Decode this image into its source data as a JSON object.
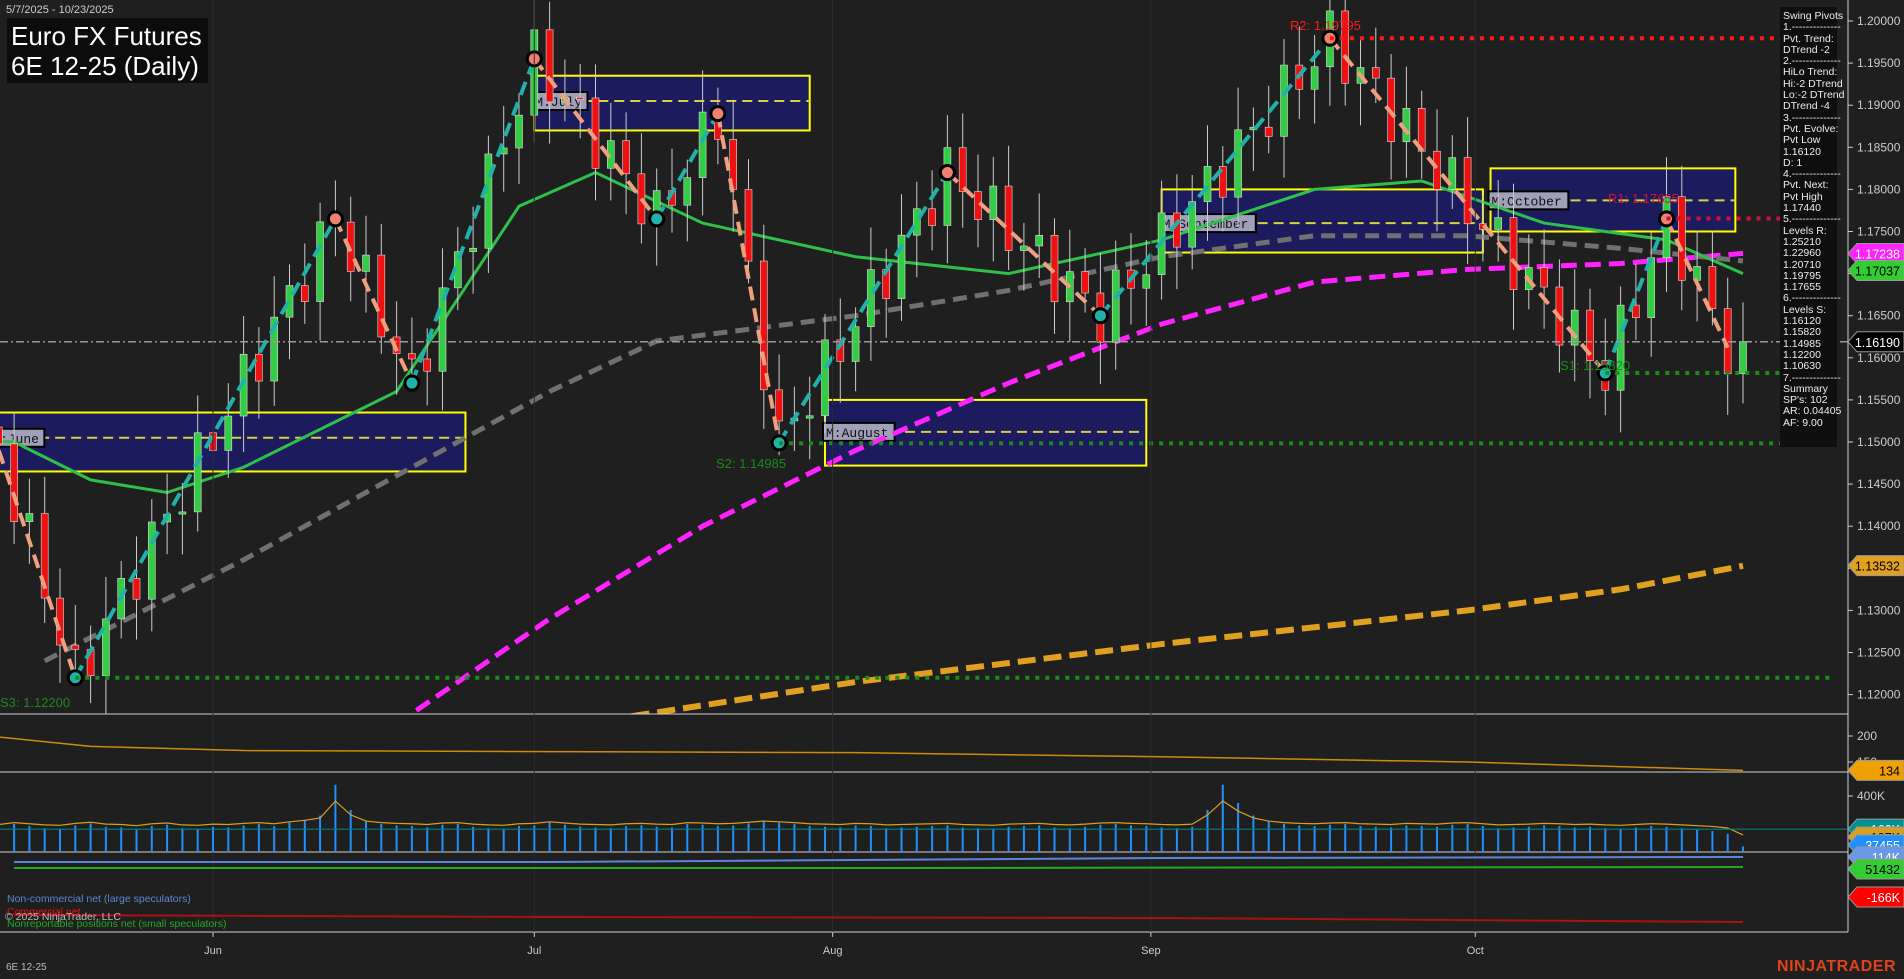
{
  "header": {
    "date_range": "5/7/2025 - 10/23/2025",
    "title_line1": "Euro FX Futures",
    "title_line2": "6E 12-25 (Daily)"
  },
  "swing_panel": [
    "Swing Pivots",
    "1.--------------",
    "Pvt. Trend:",
    "DTrend -2",
    "2.--------------",
    "HiLo Trend:",
    "Hi:-2 DTrend",
    "Lo:-2 DTrend",
    "DTrend -4",
    "3.--------------",
    "Pvt. Evolve:",
    "Pvt Low",
    "1.16120",
    "D: 1",
    "4.--------------",
    "Pvt. Next:",
    "Pvt High",
    "1.17440",
    "5.--------------",
    "Levels R:",
    "1.25210",
    "1.22960",
    "1.20710",
    "1.19795",
    "1.17655",
    "6.--------------",
    "Levels S:",
    "1.16120",
    "1.15820",
    "1.14985",
    "1.12200",
    "1.10630",
    "7.--------------",
    "Summary",
    "SP's: 102",
    "AR: 0.04405",
    "AF: 9.00"
  ],
  "legend": {
    "noncommercial": "Non-commercial net (large speculators)",
    "commercial": "Commercial net",
    "copyright": "© 2025 NinjaTrader, LLC",
    "nonreportable": "Nonreportable positions net (small speculators)"
  },
  "footer": {
    "instrument": "6E 12-25",
    "logo": "NINJATRADER"
  },
  "chart_data": {
    "type": "candlestick",
    "price_axis": {
      "ticks": [
        "1.20000",
        "1.19500",
        "1.19000",
        "1.18500",
        "1.18000",
        "1.17500",
        "1.17000",
        "1.16500",
        "1.16000",
        "1.15500",
        "1.15000",
        "1.14500",
        "1.14000",
        "1.13500",
        "1.13000",
        "1.12500",
        "1.12000"
      ],
      "range": [
        1.1165,
        1.2025
      ]
    },
    "time_axis": [
      {
        "label": "Jun",
        "bar": 18
      },
      {
        "label": "Jul",
        "bar": 39
      },
      {
        "label": "Aug",
        "bar": 58.5
      },
      {
        "label": "Sep",
        "bar": 79.3
      },
      {
        "label": "Oct",
        "bar": 100.5
      }
    ],
    "swing_pivots": [
      [
        4,
        1.149
      ],
      [
        9,
        1.122
      ],
      [
        26,
        1.1765
      ],
      [
        31,
        1.157
      ],
      [
        39,
        1.1955
      ],
      [
        47,
        1.1765
      ],
      [
        51,
        1.189
      ],
      [
        55,
        1.1499
      ],
      [
        66,
        1.182
      ],
      [
        76,
        1.165
      ],
      [
        91,
        1.19795
      ],
      [
        109,
        1.1582
      ],
      [
        113,
        1.1765
      ],
      [
        117,
        1.1612
      ],
      [
        118,
        1.1619
      ]
    ],
    "levels": [
      {
        "label": "R2: 1.19795",
        "price": 1.19795,
        "from": 91,
        "color": "#ff1a1a"
      },
      {
        "label": "R1: 1.17655",
        "price": 1.17655,
        "from": 113,
        "color": "#d0103a"
      },
      {
        "label": "S1: 1.15820",
        "price": 1.1582,
        "from": 109,
        "color": "#1a8a1a"
      },
      {
        "label": "S2: 1.14985",
        "price": 1.14985,
        "from": 55,
        "color": "#1a8a1a"
      },
      {
        "label": "S3: 1.12200",
        "price": 1.122,
        "from": 9,
        "color": "#1a8a1a"
      }
    ],
    "monthly_boxes": [
      {
        "label": "M:June",
        "from": 3.5,
        "to": 34.5,
        "high": 1.1535,
        "low": 1.1465,
        "mid": 1.1505
      },
      {
        "label": "M:July",
        "from": 39,
        "to": 57,
        "high": 1.1935,
        "low": 1.187,
        "mid": 1.1905
      },
      {
        "label": "M:August",
        "from": 58,
        "to": 79,
        "high": 1.155,
        "low": 1.1472,
        "mid": 1.1512
      },
      {
        "label": "M:September",
        "from": 80,
        "to": 101,
        "high": 1.18,
        "low": 1.1725,
        "mid": 1.176
      },
      {
        "label": "M:October",
        "from": 101.5,
        "to": 117.5,
        "high": 1.1825,
        "low": 1.175,
        "mid": 1.1787
      }
    ],
    "ma_green": [
      [
        0,
        1.1505
      ],
      [
        5,
        1.15
      ],
      [
        10,
        1.1455
      ],
      [
        15,
        1.144
      ],
      [
        20,
        1.147
      ],
      [
        30,
        1.156
      ],
      [
        38,
        1.178
      ],
      [
        43,
        1.182
      ],
      [
        50,
        1.176
      ],
      [
        60,
        1.172
      ],
      [
        70,
        1.17
      ],
      [
        80,
        1.174
      ],
      [
        90,
        1.18
      ],
      [
        97,
        1.181
      ],
      [
        105,
        1.176
      ],
      [
        113,
        1.174
      ],
      [
        118,
        1.17
      ]
    ],
    "ma_gray": [
      [
        7,
        1.124
      ],
      [
        20,
        1.136
      ],
      [
        30,
        1.146
      ],
      [
        40,
        1.156
      ],
      [
        47,
        1.162
      ],
      [
        60,
        1.165
      ],
      [
        70,
        1.168
      ],
      [
        80,
        1.172
      ],
      [
        90,
        1.1745
      ],
      [
        100,
        1.1745
      ],
      [
        110,
        1.173
      ],
      [
        118,
        1.1715
      ]
    ],
    "ma_magenta": [
      [
        30,
        1.1165
      ],
      [
        40,
        1.129
      ],
      [
        50,
        1.14
      ],
      [
        60,
        1.149
      ],
      [
        70,
        1.157
      ],
      [
        80,
        1.164
      ],
      [
        90,
        1.169
      ],
      [
        100,
        1.1705
      ],
      [
        110,
        1.1712
      ],
      [
        118,
        1.1724
      ]
    ],
    "ma_orange": [
      [
        42,
        1.1165
      ],
      [
        60,
        1.1215
      ],
      [
        80,
        1.126
      ],
      [
        100,
        1.13
      ],
      [
        110,
        1.1325
      ],
      [
        118,
        1.1353
      ]
    ],
    "last_price": 1.1619,
    "price_tags": [
      {
        "label": "1.17238",
        "color": "#ff22ff"
      },
      {
        "label": "1.17037",
        "color": "#33cc33"
      },
      {
        "label": "1.16190",
        "color": "#000000"
      },
      {
        "label": "1.13532",
        "color": "#e0a020"
      }
    ],
    "adx_panel": {
      "ticks": [
        "200",
        "150"
      ],
      "values": [
        [
          0,
          210
        ],
        [
          10,
          180
        ],
        [
          20,
          172
        ],
        [
          40,
          170
        ],
        [
          60,
          168
        ],
        [
          80,
          160
        ],
        [
          100,
          150
        ],
        [
          118,
          134
        ]
      ],
      "tag": "134"
    },
    "volume_panel": {
      "ticks": [
        "400K"
      ],
      "tags": [
        {
          "label": "163K",
          "color": "#009090"
        },
        {
          "label": "107K",
          "color": "#d8a020"
        },
        {
          "label": "37455",
          "color": "#2090ff"
        }
      ],
      "volumes_k": [
        210,
        180,
        190,
        160,
        175,
        200,
        185,
        170,
        165,
        190,
        205,
        180,
        175,
        160,
        185,
        195,
        170,
        165,
        180,
        175,
        190,
        200,
        185,
        210,
        230,
        260,
        480,
        300,
        220,
        200,
        190,
        185,
        175,
        195,
        200,
        180,
        170,
        165,
        185,
        190,
        210,
        195,
        180,
        175,
        170,
        185,
        190,
        180,
        175,
        200,
        195,
        185,
        190,
        205,
        220,
        210,
        200,
        185,
        180,
        175,
        190,
        185,
        170,
        175,
        180,
        185,
        190,
        175,
        170,
        165,
        180,
        185,
        190,
        175,
        170,
        180,
        195,
        200,
        190,
        185,
        175,
        170,
        180,
        300,
        480,
        350,
        260,
        220,
        200,
        190,
        185,
        195,
        200,
        185,
        180,
        175,
        190,
        185,
        180,
        195,
        200,
        185,
        170,
        175,
        180,
        190,
        185,
        175,
        180,
        170,
        165,
        175,
        185,
        180,
        170,
        160,
        150,
        130,
        40
      ]
    },
    "cot_panel": {
      "ticks": [
        "0"
      ],
      "tags": [
        {
          "label": "114K",
          "color": "#6a98e8"
        },
        {
          "label": "51432",
          "color": "#33cc33"
        },
        {
          "label": "-166K",
          "color": "#ff0000"
        }
      ]
    }
  }
}
